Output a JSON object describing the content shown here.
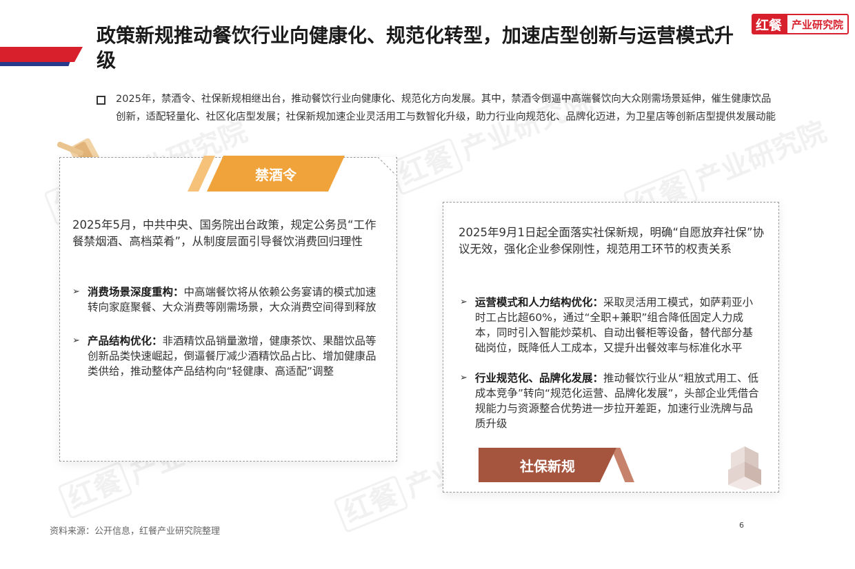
{
  "header": {
    "title": "政策新规推动餐饮行业向健康化、规范化转型，加速店型创新与运营模式升级",
    "logo_mark": "红餐",
    "logo_text": "产业研究院"
  },
  "intro": "2025年，禁酒令、社保新规相继出台，推动餐饮行业向健康化、规范化方向发展。其中，禁酒令倒逼中高端餐饮向大众刚需场景延伸，催生健康饮品创新，适配轻量化、社区化店型发展；社保新规加速企业灵活用工与数智化升级，助力行业向规范化、品牌化迈进，为卫星店等创新店型提供发展动能",
  "watermark": {
    "mark": "红餐",
    "text": "产业研究院"
  },
  "card1": {
    "tag": "禁酒令",
    "lead": "2025年5月，中共中央、国务院出台政策，规定公务员“工作餐禁烟酒、高档菜肴”，从制度层面引导餐饮消费回归理性",
    "items": [
      {
        "heading": "消费场景深度重构：",
        "body": "中高端餐饮将从依赖公务宴请的模式加速转向家庭聚餐、大众消费等刚需场景，大众消费空间得到释放"
      },
      {
        "heading": "产品结构优化：",
        "body": "非酒精饮品销量激增，健康茶饮、果醋饮品等创新品类快速崛起，倒逼餐厅减少酒精饮品占比、增加健康品类供给，推动整体产品结构向“轻健康、高适配”调整"
      }
    ]
  },
  "card2": {
    "tag": "社保新规",
    "lead": "2025年9月1日起全面落实社保新规，明确“自愿放弃社保”协议无效，强化企业参保刚性，规范用工环节的权责关系",
    "items": [
      {
        "heading": "运营模式和人力结构优化：",
        "body": "采取灵活用工模式，如萨莉亚小时工占比超60%，通过“全职+兼职”组合降低固定人力成本，同时引入智能炒菜机、自动出餐柜等设备，替代部分基础岗位，既降低人工成本，又提升出餐效率与标准化水平"
      },
      {
        "heading": "行业规范化、品牌化发展：",
        "body": "推动餐饮行业从“粗放式用工、低成本竞争”转向“规范化运营、品牌化发展”，头部企业凭借合规能力与资源整合优势进一步拉开差距，加速行业洗牌与品质升级"
      }
    ]
  },
  "footer": {
    "source": "资料来源：公开信息，红餐产业研究院整理",
    "page": "6"
  },
  "colors": {
    "accent_red": "#d7202c",
    "accent_blue": "#2a3a8a",
    "tag_orange": "#f0a33a",
    "tag_brown": "#a5553e"
  }
}
